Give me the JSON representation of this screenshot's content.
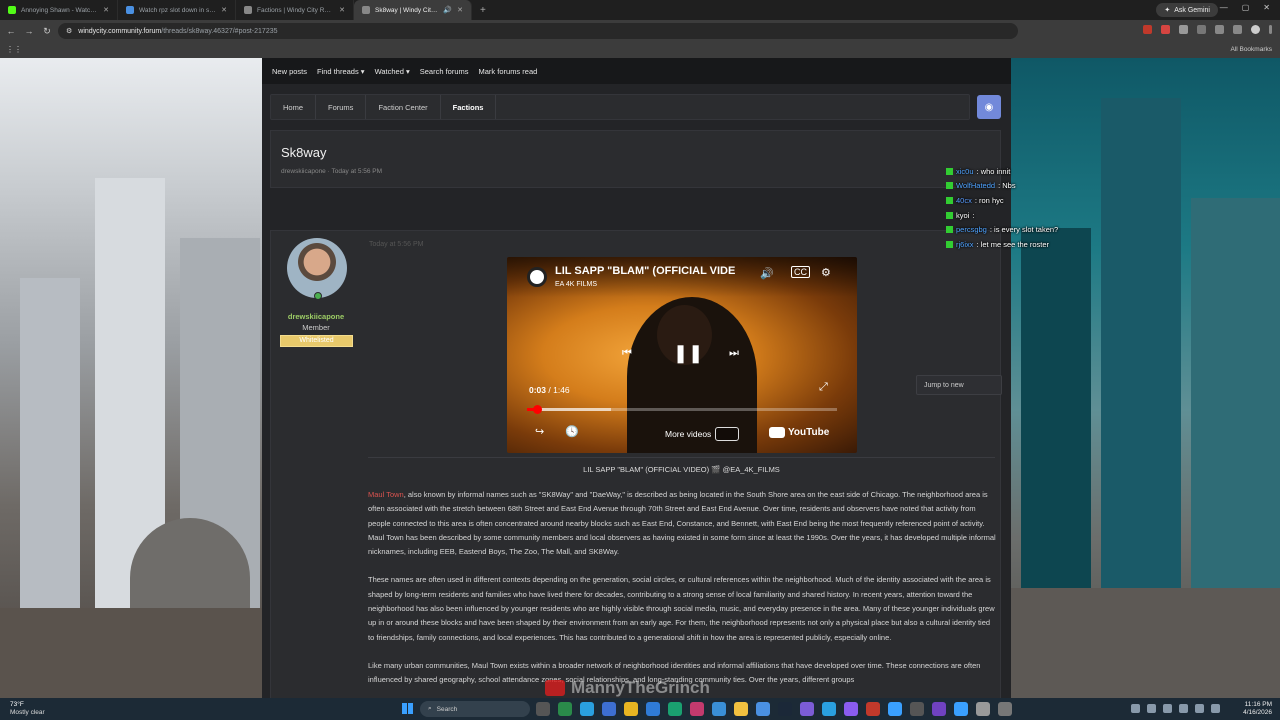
{
  "browser": {
    "tabs": [
      {
        "title": "Annoying Shawn - Watch Live",
        "favicon_color": "#53fc18",
        "active": false
      },
      {
        "title": "Watch rpz slot down in some",
        "favicon_color": "#4a90e2",
        "active": false
      },
      {
        "title": "Factions | Windy City Roleplay",
        "favicon_color": "#888888",
        "active": false
      },
      {
        "title": "Sk8way | Windy City Roleplay",
        "favicon_color": "#888888",
        "active": true
      }
    ],
    "new_tab": "+",
    "ask_gemini": "Ask Gemini",
    "url_host": "windycity.community.forum",
    "url_path": "/threads/sk8way.46327/#post-217235",
    "all_bookmarks": "All Bookmarks"
  },
  "forum_nav": [
    "New posts",
    "Find threads ▾",
    "Watched ▾",
    "Search forums",
    "Mark forums read"
  ],
  "breadcrumbs": [
    "Home",
    "Forums",
    "Faction Center",
    "Factions"
  ],
  "thread": {
    "title": "Sk8way",
    "meta": "drewskiicapone · Today at 5:56 PM"
  },
  "jump_button": "Jump to new",
  "post": {
    "author": "drewskiicapone",
    "role": "Member",
    "badge": "Whitelisted",
    "time": "Today at 5:56 PM",
    "video": {
      "title": "LIL SAPP \"BLAM\" (OFFICIAL VIDE",
      "channel": "EA 4K FILMS",
      "current_time": "0:03",
      "duration": " / 1:46",
      "progress": 0.03,
      "buffered": 0.27,
      "more_videos": "More videos",
      "youtube": "YouTube"
    },
    "caption": "LIL SAPP \"BLAM\" (OFFICIAL VIDEO) 🎬 @EA_4K_FILMS",
    "link_text": "Maul Town",
    "paragraphs": [
      ", also known by informal names such as \"SK8Way\" and \"DaeWay,\" is described as being located in the South Shore area on the east side of Chicago. The neighborhood area is often associated with the stretch between 68th Street and East End Avenue through 70th Street and East End Avenue. Over time, residents and observers have noted that activity from people connected to this area is often concentrated around nearby blocks such as East End, Constance, and Bennett, with East End being the most frequently referenced point of activity. Maul Town has been described by some community members and local observers as having existed in some form since at least the 1990s. Over the years, it has developed multiple informal nicknames, including EEB, Eastend Boys, The Zoo, The Mall, and SK8Way.",
      "These names are often used in different contexts depending on the generation, social circles, or cultural references within the neighborhood. Much of the identity associated with the area is shaped by long-term residents and families who have lived there for decades, contributing to a strong sense of local familiarity and shared history. In recent years, attention toward the neighborhood has also been influenced by younger residents who are highly visible through social media, music, and everyday presence in the area. Many of these younger individuals grew up in or around these blocks and have been shaped by their environment from an early age. For them, the neighborhood represents not only a physical place but also a cultural identity tied to friendships, family connections, and local experiences. This has contributed to a generational shift in how the area is represented publicly, especially online.",
      "Like many urban communities, Maul Town exists within a broader network of neighborhood identities and informal affiliations that have developed over time. These connections are often influenced by shared geography, school attendance zones, social relationships, and long-standing community ties. Over the years, different groups"
    ]
  },
  "chat": [
    {
      "user": "xic0u",
      "color": "#4fa3ff",
      "message": "who innit"
    },
    {
      "user": "WolfHatedd",
      "color": "#4fa3ff",
      "message": "Nbs"
    },
    {
      "user": "40cx",
      "color": "#5a9cff",
      "message": "ron hyc"
    },
    {
      "user": "kyoi",
      "color": "#ffffff",
      "message": ""
    },
    {
      "user": "percsgbg",
      "color": "#4fa3ff",
      "message": "is every slot taken?"
    },
    {
      "user": "rj6ixx",
      "color": "#4fa3ff",
      "message": "let me see the roster"
    }
  ],
  "watermark": "MannyTheGrinch",
  "taskbar": {
    "temp": "73°F",
    "weather": "Mostly clear",
    "search": "Search",
    "time": "11:16 PM",
    "date": "4/16/2026",
    "app_colors": [
      "#555",
      "#2a8a4a",
      "#2aa0e0",
      "#3d6fd1",
      "#e6b422",
      "#2f7bd6",
      "#1aa070",
      "#c23a6e",
      "#3a8fd6",
      "#f0c040",
      "#4a90e2",
      "#1b2838",
      "#7b5cd6",
      "#2aa0e0",
      "#8a5cf0",
      "#c0392b",
      "#3aa0ff",
      "#555",
      "#6f42c1",
      "#3aa0ff",
      "#999",
      "#777"
    ]
  }
}
